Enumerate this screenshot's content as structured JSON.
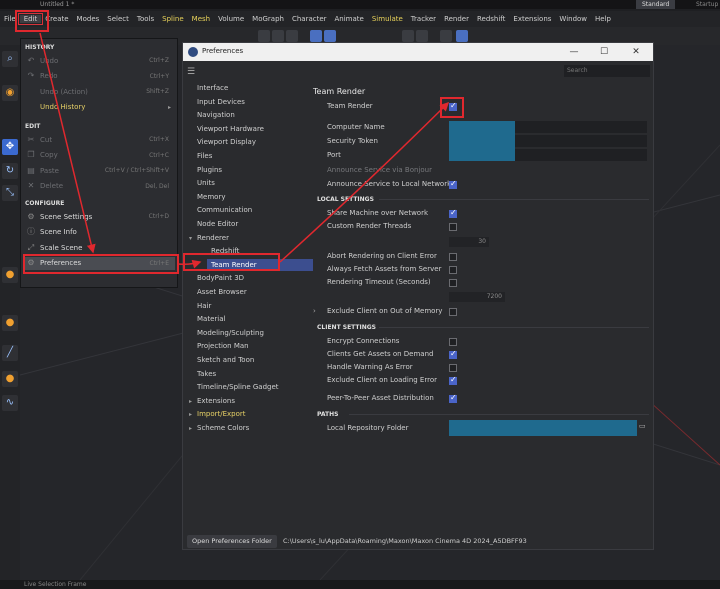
{
  "titlebar": {
    "tab": "Untitled 1",
    "tab_marker": "*",
    "mode_active": "Standard",
    "mode_other": "Startup"
  },
  "menubar": {
    "items": [
      {
        "label": "File",
        "style": ""
      },
      {
        "label": "Edit",
        "style": "active"
      },
      {
        "label": "Create",
        "style": ""
      },
      {
        "label": "Modes",
        "style": ""
      },
      {
        "label": "Select",
        "style": ""
      },
      {
        "label": "Tools",
        "style": ""
      },
      {
        "label": "Spline",
        "style": "yellow"
      },
      {
        "label": "Mesh",
        "style": "yellow"
      },
      {
        "label": "Volume",
        "style": ""
      },
      {
        "label": "MoGraph",
        "style": ""
      },
      {
        "label": "Character",
        "style": ""
      },
      {
        "label": "Animate",
        "style": ""
      },
      {
        "label": "Simulate",
        "style": "yellow"
      },
      {
        "label": "Tracker",
        "style": ""
      },
      {
        "label": "Render",
        "style": ""
      },
      {
        "label": "Redshift",
        "style": ""
      },
      {
        "label": "Extensions",
        "style": ""
      },
      {
        "label": "Window",
        "style": ""
      },
      {
        "label": "Help",
        "style": ""
      }
    ]
  },
  "editmenu": {
    "history_header": "HISTORY",
    "edit_header": "EDIT",
    "configure_header": "CONFIGURE",
    "history": [
      {
        "label": "Undo",
        "shortcut": "Ctrl+Z",
        "icon": "undo-icon",
        "state": "dim"
      },
      {
        "label": "Redo",
        "shortcut": "Ctrl+Y",
        "icon": "redo-icon",
        "state": "dim"
      },
      {
        "label": "Undo (Action)",
        "shortcut": "Shift+Z",
        "icon": "",
        "state": "dim"
      },
      {
        "label": "Undo History",
        "shortcut": "",
        "icon": "",
        "state": "hl"
      }
    ],
    "edit": [
      {
        "label": "Cut",
        "shortcut": "Ctrl+X",
        "icon": "scissors-icon",
        "state": "dim"
      },
      {
        "label": "Copy",
        "shortcut": "Ctrl+C",
        "icon": "copy-icon",
        "state": "dim"
      },
      {
        "label": "Paste",
        "shortcut": "Ctrl+V / Ctrl+Shift+V",
        "icon": "paste-icon",
        "state": "dim"
      },
      {
        "label": "Delete",
        "shortcut": "Del, Del",
        "icon": "delete-icon",
        "state": "dim"
      }
    ],
    "configure": [
      {
        "label": "Scene Settings",
        "shortcut": "Ctrl+D",
        "icon": "scene-settings-icon",
        "state": ""
      },
      {
        "label": "Scene Info",
        "shortcut": "",
        "icon": "info-icon",
        "state": ""
      },
      {
        "label": "Scale Scene",
        "shortcut": "",
        "icon": "scale-icon",
        "state": ""
      },
      {
        "label": "Preferences",
        "shortcut": "Ctrl+E",
        "icon": "gear-icon",
        "state": "sel"
      }
    ]
  },
  "prefs": {
    "window_title": "Preferences",
    "search_placeholder": "Search",
    "tree": [
      {
        "label": "Interface",
        "indent": 0,
        "style": ""
      },
      {
        "label": "Input Devices",
        "indent": 0,
        "style": ""
      },
      {
        "label": "Navigation",
        "indent": 0,
        "style": ""
      },
      {
        "label": "Viewport Hardware",
        "indent": 0,
        "style": ""
      },
      {
        "label": "Viewport Display",
        "indent": 0,
        "style": ""
      },
      {
        "label": "Files",
        "indent": 0,
        "style": ""
      },
      {
        "label": "Plugins",
        "indent": 0,
        "style": ""
      },
      {
        "label": "Units",
        "indent": 0,
        "style": ""
      },
      {
        "label": "Memory",
        "indent": 0,
        "style": ""
      },
      {
        "label": "Communication",
        "indent": 0,
        "style": ""
      },
      {
        "label": "Node Editor",
        "indent": 0,
        "style": ""
      },
      {
        "label": "Renderer",
        "indent": 0,
        "style": "expanded"
      },
      {
        "label": "Redshift",
        "indent": 1,
        "style": ""
      },
      {
        "label": "Team Render",
        "indent": 1,
        "style": "sel"
      },
      {
        "label": "BodyPaint 3D",
        "indent": 0,
        "style": ""
      },
      {
        "label": "Asset Browser",
        "indent": 0,
        "style": ""
      },
      {
        "label": "Hair",
        "indent": 0,
        "style": ""
      },
      {
        "label": "Material",
        "indent": 0,
        "style": ""
      },
      {
        "label": "Modeling/Sculpting",
        "indent": 0,
        "style": ""
      },
      {
        "label": "Projection Man",
        "indent": 0,
        "style": ""
      },
      {
        "label": "Sketch and Toon",
        "indent": 0,
        "style": ""
      },
      {
        "label": "Takes",
        "indent": 0,
        "style": ""
      },
      {
        "label": "Timeline/Spline Gadget",
        "indent": 0,
        "style": ""
      },
      {
        "label": "Extensions",
        "indent": 0,
        "style": "collapsed"
      },
      {
        "label": "Import/Export",
        "indent": 0,
        "style": "collapsed-yellow"
      },
      {
        "label": "Scheme Colors",
        "indent": 0,
        "style": "collapsed"
      }
    ],
    "panel": {
      "title": "Team Render",
      "team_render_label": "Team Render",
      "team_render_checked": true,
      "computer_name_label": "Computer Name",
      "security_token_label": "Security Token",
      "port_label": "Port",
      "announce_bonjour_label": "Announce Service via Bonjour",
      "announce_local_label": "Announce Service to Local Network",
      "announce_local_checked": true,
      "local_settings_header": "LOCAL SETTINGS",
      "share_machine_label": "Share Machine over Network",
      "share_machine_checked": true,
      "custom_threads_label": "Custom Render Threads",
      "custom_threads_checked": false,
      "threads_value": "30",
      "abort_label": "Abort Rendering on Client Error",
      "always_fetch_label": "Always Fetch Assets from Server",
      "timeout_label": "Rendering Timeout (Seconds)",
      "timeout_value": "7200",
      "exclude_oom_label": "Exclude Client on Out of Memory",
      "client_settings_header": "CLIENT SETTINGS",
      "encrypt_label": "Encrypt Connections",
      "encrypt_checked": false,
      "clients_get_label": "Clients Get Assets on Demand",
      "clients_get_checked": true,
      "handle_warning_label": "Handle Warning As Error",
      "handle_warning_checked": false,
      "exclude_loading_label": "Exclude Client on Loading Error",
      "exclude_loading_checked": true,
      "p2p_label": "Peer-To-Peer Asset Distribution",
      "p2p_checked": true,
      "paths_header": "PATHS",
      "local_repo_label": "Local Repository Folder"
    },
    "footer": {
      "button": "Open Preferences Folder",
      "path": "C:\\Users\\s_lu\\AppData\\Roaming\\Maxon\\Maxon Cinema 4D 2024_A5DBFF93"
    }
  },
  "statusbar": {
    "text": "Live Selection Frame"
  },
  "colors": {
    "accent": "#4a64c8",
    "annotation": "#e0282e",
    "highlight": "#1f6a8e"
  }
}
